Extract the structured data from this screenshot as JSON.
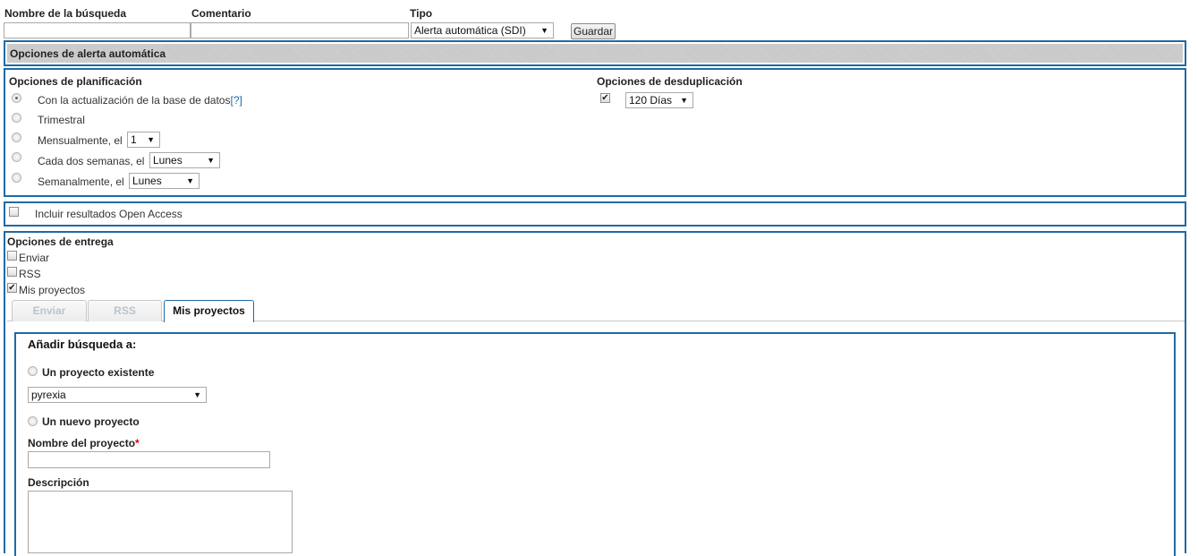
{
  "search_form": {
    "name_label": "Nombre de la búsqueda",
    "comment_label": "Comentario",
    "type_label": "Tipo",
    "type_value": "Alerta automática (SDI)",
    "save_label": "Guardar"
  },
  "alert_header": "Opciones de alerta automática",
  "scheduling": {
    "title": "Opciones de planificación",
    "options": [
      {
        "label": "Con la actualización de la base de datos",
        "help": "[?]"
      },
      {
        "label": "Trimestral"
      },
      {
        "label": "Mensualmente, el",
        "select": "1"
      },
      {
        "label": "Cada dos semanas, el",
        "select": "Lunes"
      },
      {
        "label": "Semanalmente, el",
        "select": "Lunes"
      }
    ]
  },
  "dedup": {
    "title": "Opciones de desduplicación",
    "value": "120 Días"
  },
  "open_access": {
    "label": "Incluir resultados Open Access"
  },
  "delivery": {
    "title": "Opciones de entrega",
    "options": [
      "Enviar",
      "RSS",
      "Mis proyectos"
    ],
    "tabs": [
      "Enviar",
      "RSS",
      "Mis proyectos"
    ]
  },
  "projects": {
    "title": "Añadir búsqueda a:",
    "existing_label": "Un proyecto existente",
    "existing_value": "pyrexia",
    "new_label": "Un nuevo proyecto",
    "name_label": "Nombre del proyecto",
    "required_mark": "*",
    "description_label": "Descripción"
  },
  "colors": {
    "panel_border": "#1f6aa5",
    "required": "#dd0000"
  }
}
